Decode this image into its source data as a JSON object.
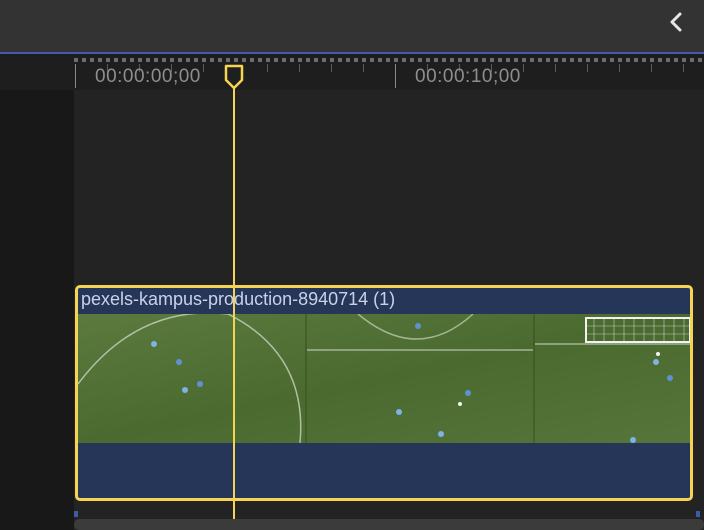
{
  "toolbar": {
    "collapse_icon": "chevron-left-icon"
  },
  "ruler": {
    "timecodes": [
      "00:00:00;00",
      "00:00:10;00"
    ]
  },
  "playhead": {
    "icon": "playhead-icon"
  },
  "clip": {
    "title": "pexels-kampus-production-8940714 (1)",
    "selected": true
  },
  "colors": {
    "accent": "#f5d453",
    "clip_body": "#263658",
    "timeline_bg": "#232323",
    "topbar": "#333333",
    "ruler_text": "#8e8e8e",
    "separator_blue": "#4b55b4"
  }
}
